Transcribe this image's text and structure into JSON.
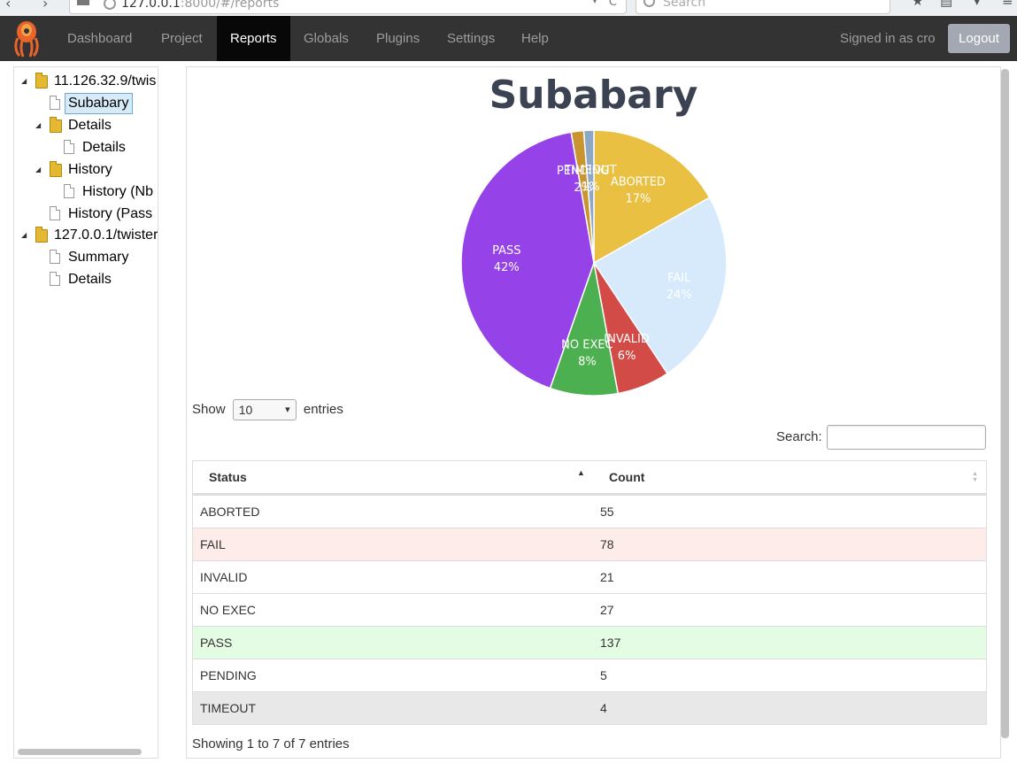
{
  "browser": {
    "url_host": "127.0.0.1",
    "url_rest": ":8000/#/reports",
    "search_placeholder": "Search"
  },
  "nav": {
    "items": [
      {
        "label": "Dashboard",
        "active": false
      },
      {
        "label": "Project",
        "active": false
      },
      {
        "label": "Reports",
        "active": true
      },
      {
        "label": "Globals",
        "active": false
      },
      {
        "label": "Plugins",
        "active": false
      },
      {
        "label": "Settings",
        "active": false
      },
      {
        "label": "Help",
        "active": false
      }
    ],
    "signed_in": "Signed in as cro",
    "logout": "Logout"
  },
  "tree": {
    "nodes": [
      {
        "label": "11.126.32.9/twis",
        "type": "folder"
      },
      {
        "label": "Subabary",
        "type": "file",
        "selected": true
      },
      {
        "label": "Details",
        "type": "folder"
      },
      {
        "label": "Details",
        "type": "file"
      },
      {
        "label": "History",
        "type": "folder"
      },
      {
        "label": "History (Nb",
        "type": "file"
      },
      {
        "label": "History (Pass",
        "type": "file"
      },
      {
        "label": "127.0.0.1/twister",
        "type": "folder"
      },
      {
        "label": "Summary",
        "type": "file"
      },
      {
        "label": "Details",
        "type": "file"
      }
    ]
  },
  "report": {
    "title": "Subabary",
    "show_label": "Show",
    "entries_value": "10",
    "entries_label": "entries",
    "search_label": "Search:",
    "columns": [
      "Status",
      "Count"
    ],
    "rows": [
      {
        "status": "ABORTED",
        "count": "55"
      },
      {
        "status": "FAIL",
        "count": "78"
      },
      {
        "status": "INVALID",
        "count": "21"
      },
      {
        "status": "NO EXEC",
        "count": "27"
      },
      {
        "status": "PASS",
        "count": "137"
      },
      {
        "status": "PENDING",
        "count": "5"
      },
      {
        "status": "TIMEOUT",
        "count": "4"
      }
    ],
    "footer": "Showing 1 to 7 of 7 entries"
  },
  "chart_data": {
    "type": "pie",
    "title": "Subabary",
    "slices": [
      {
        "label": "ABORTED",
        "value": 55,
        "pct": "17%",
        "color": "#eac043"
      },
      {
        "label": "FAIL",
        "value": 78,
        "pct": "24%",
        "color": "#d6eafc"
      },
      {
        "label": "INVALID",
        "value": 21,
        "pct": "6%",
        "color": "#d24b47"
      },
      {
        "label": "NO EXEC",
        "value": 27,
        "pct": "8%",
        "color": "#4caf50"
      },
      {
        "label": "PASS",
        "value": 137,
        "pct": "42%",
        "color": "#9543e8"
      },
      {
        "label": "PENDING",
        "value": 5,
        "pct": "2%",
        "color": "#c9952f"
      },
      {
        "label": "TIMEOUT",
        "value": 4,
        "pct": "1%",
        "color": "#8ea7c4"
      }
    ]
  }
}
